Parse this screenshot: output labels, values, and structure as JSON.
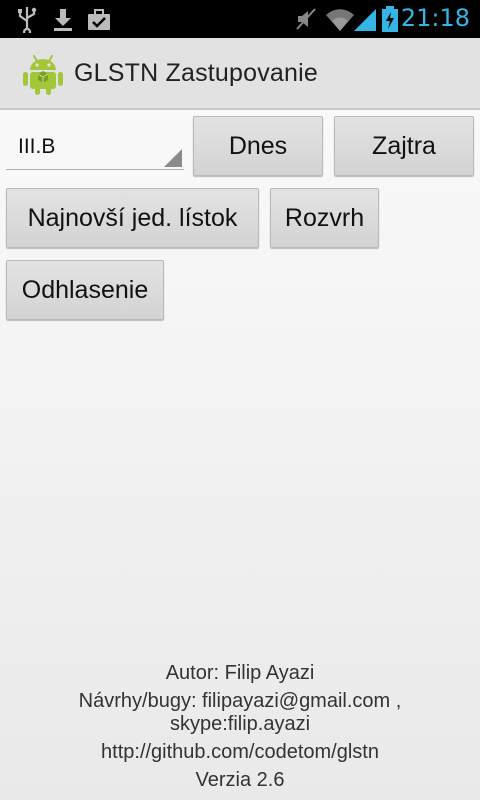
{
  "status_bar": {
    "time": "21:18",
    "accent_color": "#33b5e5",
    "icons": [
      "usb-icon",
      "download-icon",
      "briefcase-check-icon",
      "mute-icon",
      "wifi-icon",
      "signal-icon",
      "battery-charging-icon"
    ]
  },
  "action_bar": {
    "title": "GLSTN Zastupovanie",
    "logo": "android-icon"
  },
  "class_spinner": {
    "selected": "III.B"
  },
  "buttons": {
    "today": "Dnes",
    "tomorrow": "Zajtra",
    "menu": "Najnovší jed. lístok",
    "schedule": "Rozvrh",
    "logout": "Odhlasenie"
  },
  "footer": {
    "author": "Autor: Filip Ayazi",
    "suggestions": "Návrhy/bugy: filipayazi@gmail.com ,",
    "skype": "skype:filip.ayazi",
    "github": "http://github.com/codetom/glstn",
    "version": "Verzia 2.6"
  }
}
